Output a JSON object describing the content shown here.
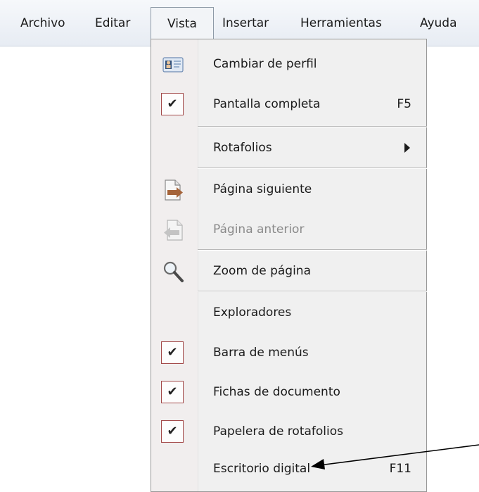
{
  "menubar": {
    "items": [
      {
        "label": "Archivo"
      },
      {
        "label": "Editar"
      },
      {
        "label": "Vista",
        "active": true
      },
      {
        "label": "Insertar"
      },
      {
        "label": "Herramientas"
      },
      {
        "label": "Ayuda"
      }
    ]
  },
  "vista_menu": {
    "items": [
      {
        "label": "Cambiar de perfil",
        "icon": "profile-card-icon"
      },
      {
        "label": "Pantalla completa",
        "shortcut": "F5",
        "checked": true
      },
      {
        "label": "Rotafolios",
        "submenu": true
      },
      {
        "label": "Página siguiente",
        "icon": "next-page-icon"
      },
      {
        "label": "Página anterior",
        "icon": "previous-page-icon",
        "disabled": true
      },
      {
        "label": "Zoom de página",
        "icon": "magnifier-icon"
      },
      {
        "label": "Exploradores"
      },
      {
        "label": "Barra de menús",
        "checked": true
      },
      {
        "label": "Fichas de documento",
        "checked": true
      },
      {
        "label": "Papelera de rotafolios",
        "checked": true
      },
      {
        "label": "Escritorio digital",
        "shortcut": "F11"
      }
    ],
    "check_glyph": "✔"
  },
  "colors": {
    "menubar_bg": "#e7ecf3",
    "menu_bg": "#f0f0f0",
    "check_border": "#a34a4a",
    "disabled_text": "#8a8a8a"
  }
}
